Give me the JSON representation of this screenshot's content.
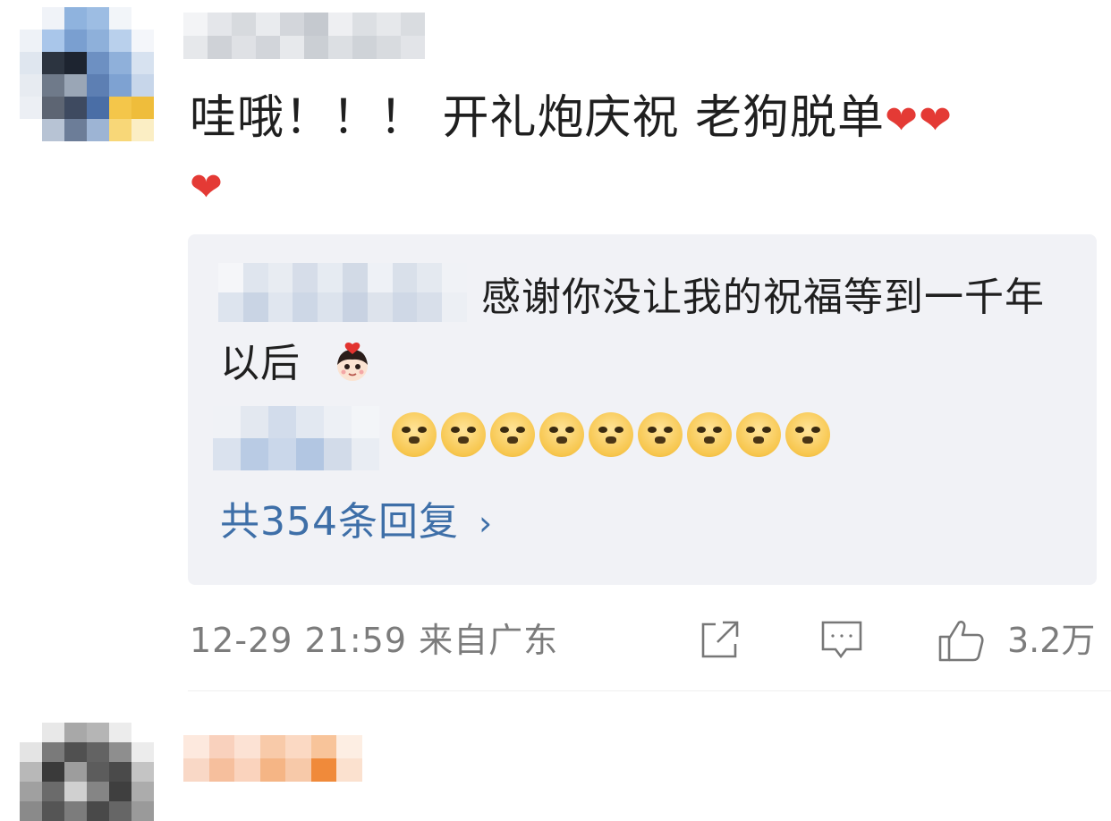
{
  "comments": [
    {
      "text": "哇哦！！！ 开礼炮庆祝 老狗脱单",
      "hearts": [
        "❤",
        "❤",
        "❤"
      ],
      "replies": [
        {
          "text": "感谢你没让我的祝福等到一千年以后",
          "emoji": "boy-face-with-heart"
        },
        {
          "emoji": "doge",
          "count": 9
        }
      ],
      "reply_count_label": "共354条回复",
      "chevron": "›",
      "timestamp": "12-29 21:59",
      "location": "来自广东",
      "likes": "3.2万"
    },
    {
      "text": "……"
    }
  ],
  "colors": {
    "link": "#3e6fa8",
    "meta": "#7c7c7c",
    "reply_bg": "#f1f2f6",
    "heart": "#e43a35"
  }
}
